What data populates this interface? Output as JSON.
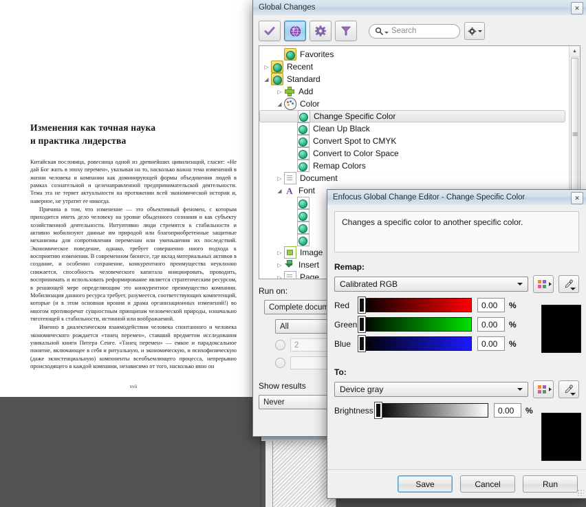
{
  "document": {
    "title_lines": [
      "Изменения как точная наука",
      "и практика лидерства"
    ],
    "paragraphs": [
      "Китайская пословица, ровесница одной из древнейших цивилизаций, гласит: «Не дай Бог жить в эпоху перемен», указывая на то, насколько важна тема изменений в жизни человека и компании как доминирующей формы объединения людей в рамках сознательной и целенаправленной предпринимательской деятельности. Тема эта не теряет актуальности на протяжении всей экономической истории и, наверное, не утратит ее никогда.",
      "Причина в том, что изменение — это объективный феномен, с которым приходится иметь дело человеку на уровне обыденного сознания и как субъекту хозяйственной деятельности. Интуитивно люди стремятся к стабильности и активно мобилизуют данные им природой или благоприобретенные защитные механизмы для сопротивления переменам или уменьшения их последствий. Экономическое поведение, однако, требует совершенно иного подхода к восприятию изменения. В современном бизнесе, где вклад материальных активов в создание, и особенно сохранение, конкурентного преимущества неуклонно снижается, способность человеческого капитала инициировать, проводить, воспринимать и использовать реформирование является стратегическим ресурсом, в решающей мере определяющим это конкурентное преимущество компании. Мобилизация данного ресурса требует, разумеется, соответствующих компетенций, которые (и в этом основная ирония и драма организационных изменений!) во многом противоречат сущностным принципам человеческой природы, изначально тяготеющей к стабильности, истинной или воображаемой.",
      "Именно в диалектическом взаимодействии человека спонтанного и человека экономического рождается «танец перемен», ставший предметом исследования уникальной книги Питера Сенге. «Танец перемен» — емкое и парадоксальное понятие, включающее в себя и ритуальную, и экономическую, и психофизическую (даже экзистенциальную) компоненты всеобъемлющего процесса, непрерывно происходящего в каждой компании, независимо от того, насколько явно он"
    ],
    "folio": "xvii"
  },
  "global_changes": {
    "title": "Global Changes",
    "close_label": "✕",
    "toolbar": {
      "check_icon": "check-icon",
      "globe_icon": "globe-icon",
      "gear_icon": "gear-icon",
      "filter_icon": "filter-icon",
      "search_placeholder": "Search",
      "search_value": "",
      "options_icon": "gear-dropdown-icon"
    },
    "tree": [
      {
        "label": "Favorites",
        "indent": 1,
        "twist": "",
        "icon": "folder-globe-icon",
        "selected": false
      },
      {
        "label": "Recent",
        "indent": 0,
        "twist": "▷",
        "icon": "folder-globe-icon",
        "selected": false
      },
      {
        "label": "Standard",
        "indent": 0,
        "twist": "◢",
        "icon": "folder-globe-icon",
        "selected": false
      },
      {
        "label": "Add",
        "indent": 1,
        "twist": "▷",
        "icon": "plus-icon",
        "selected": false
      },
      {
        "label": "Color",
        "indent": 1,
        "twist": "◢",
        "icon": "palette-icon",
        "selected": false
      },
      {
        "label": "Change Specific Color",
        "indent": 2,
        "twist": "",
        "icon": "doc-globe-icon",
        "selected": true
      },
      {
        "label": "Clean Up Black",
        "indent": 2,
        "twist": "",
        "icon": "doc-globe-icon",
        "selected": false
      },
      {
        "label": "Convert Spot to CMYK",
        "indent": 2,
        "twist": "",
        "icon": "doc-globe-icon",
        "selected": false
      },
      {
        "label": "Convert to Color Space",
        "indent": 2,
        "twist": "",
        "icon": "doc-globe-icon",
        "selected": false
      },
      {
        "label": "Remap Colors",
        "indent": 2,
        "twist": "",
        "icon": "doc-globe-icon",
        "selected": false
      },
      {
        "label": "Document",
        "indent": 1,
        "twist": "▷",
        "icon": "page-icon",
        "selected": false
      },
      {
        "label": "Font",
        "indent": 1,
        "twist": "◢",
        "icon": "font-a-icon",
        "selected": false
      },
      {
        "label": "",
        "indent": 2,
        "twist": "",
        "icon": "doc-globe-icon",
        "selected": false
      },
      {
        "label": "",
        "indent": 2,
        "twist": "",
        "icon": "doc-globe-icon",
        "selected": false
      },
      {
        "label": "",
        "indent": 2,
        "twist": "",
        "icon": "doc-globe-icon",
        "selected": false
      },
      {
        "label": "",
        "indent": 2,
        "twist": "",
        "icon": "doc-globe-icon",
        "selected": false
      },
      {
        "label": "Image",
        "indent": 1,
        "twist": "▷",
        "icon": "image-icon",
        "selected": false
      },
      {
        "label": "Insert",
        "indent": 1,
        "twist": "▷",
        "icon": "insert-icon",
        "selected": false
      },
      {
        "label": "Page",
        "indent": 1,
        "twist": "▷",
        "icon": "page-icon",
        "selected": false
      }
    ],
    "run_on": {
      "label": "Run on:",
      "scope_value": "Complete document",
      "pages_value": "All",
      "radio1_value": "2",
      "radio2_value": ""
    },
    "show_results": {
      "label": "Show results",
      "value": "Never"
    }
  },
  "editor": {
    "title": "Enfocus Global Change Editor - Change Specific Color",
    "close_label": "✕",
    "description": "Changes a specific color to another specific color.",
    "remap": {
      "label": "Remap:",
      "colorspace": "Calibrated RGB",
      "palette_icon": "color-palette-icon",
      "eyedropper_icon": "eyedropper-icon",
      "channels": [
        {
          "name": "Red",
          "value": "0.00",
          "unit": "%"
        },
        {
          "name": "Green",
          "value": "0.00",
          "unit": "%"
        },
        {
          "name": "Blue",
          "value": "0.00",
          "unit": "%"
        }
      ],
      "preview_color": "#000000"
    },
    "to": {
      "label": "To:",
      "colorspace": "Device gray",
      "palette_icon": "color-palette-icon",
      "eyedropper_icon": "eyedropper-icon",
      "channels": [
        {
          "name": "Brightness",
          "value": "0.00",
          "unit": "%"
        }
      ],
      "preview_color": "#000000"
    },
    "buttons": {
      "save": "Save",
      "cancel": "Cancel",
      "run": "Run"
    }
  }
}
